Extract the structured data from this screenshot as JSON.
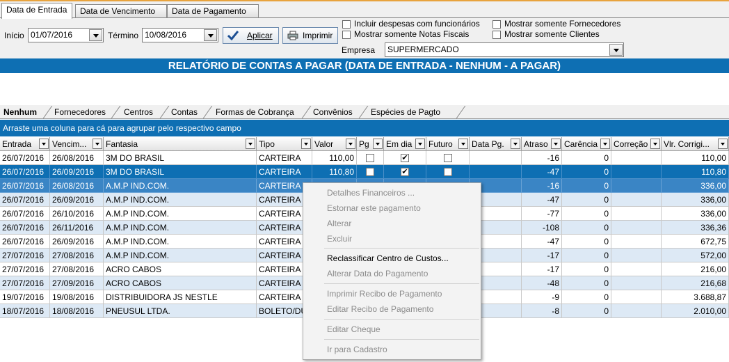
{
  "top_tabs": [
    "Data de Entrada",
    "Data de Vencimento",
    "Data de Pagamento"
  ],
  "filters": {
    "inicio_label": "Início",
    "inicio_value": "01/07/2016",
    "termino_label": "Término",
    "termino_value": "10/08/2016",
    "aplicar_label": "Aplicar",
    "imprimir_label": "Imprimir",
    "checks": [
      {
        "label": "Incluir despesas com funcionários",
        "checked": false
      },
      {
        "label": "Mostrar somente Notas Fiscais",
        "checked": false
      },
      {
        "label": "Mostrar somente Fornecedores",
        "checked": false
      },
      {
        "label": "Mostrar somente Clientes",
        "checked": false
      }
    ],
    "empresa_label": "Empresa",
    "empresa_value": "SUPERMERCADO"
  },
  "report_title": "RELATÓRIO DE CONTAS A PAGAR (DATA DE ENTRADA - NENHUM - A PAGAR)",
  "group_tabs": [
    "Nenhum",
    "Fornecedores",
    "Centros",
    "Contas",
    "Formas de Cobrança",
    "Convênios",
    "Espécies de Pagto"
  ],
  "group_hint": "Arraste uma coluna para cá para agrupar pelo respectivo campo",
  "columns": [
    "Entrada",
    "Vencim...",
    "Fantasia",
    "Tipo",
    "Valor",
    "Pg",
    "Em dia",
    "Futuro",
    "Data Pg.",
    "Atraso",
    "Carência",
    "Correção",
    "Vlr. Corrigi..."
  ],
  "rows": [
    [
      "26/07/2016",
      "26/08/2016",
      "3M DO BRASIL",
      "CARTEIRA",
      "110,00",
      "",
      "",
      "",
      "",
      "-16",
      "0",
      "",
      "110,00"
    ],
    [
      "26/07/2016",
      "26/09/2016",
      "3M DO BRASIL",
      "CARTEIRA",
      "110,80",
      "",
      "",
      "",
      "",
      "-47",
      "0",
      "",
      "110,80"
    ],
    [
      "26/07/2016",
      "26/08/2016",
      "A.M.P IND.COM.",
      "CARTEIRA",
      "",
      "",
      "",
      "",
      "",
      "-16",
      "0",
      "",
      "336,00"
    ],
    [
      "26/07/2016",
      "26/09/2016",
      "A.M.P IND.COM.",
      "CARTEIRA",
      "",
      "",
      "",
      "",
      "",
      "-47",
      "0",
      "",
      "336,00"
    ],
    [
      "26/07/2016",
      "26/10/2016",
      "A.M.P IND.COM.",
      "CARTEIRA",
      "",
      "",
      "",
      "",
      "",
      "-77",
      "0",
      "",
      "336,00"
    ],
    [
      "26/07/2016",
      "26/11/2016",
      "A.M.P IND.COM.",
      "CARTEIRA",
      "",
      "",
      "",
      "",
      "",
      "-108",
      "0",
      "",
      "336,36"
    ],
    [
      "26/07/2016",
      "26/09/2016",
      "A.M.P IND.COM.",
      "CARTEIRA",
      "",
      "",
      "",
      "",
      "",
      "-47",
      "0",
      "",
      "672,75"
    ],
    [
      "27/07/2016",
      "27/08/2016",
      "A.M.P IND.COM.",
      "CARTEIRA",
      "",
      "",
      "",
      "",
      "",
      "-17",
      "0",
      "",
      "572,00"
    ],
    [
      "27/07/2016",
      "27/08/2016",
      "ACRO CABOS",
      "CARTEIRA",
      "",
      "",
      "",
      "",
      "",
      "-17",
      "0",
      "",
      "216,00"
    ],
    [
      "27/07/2016",
      "27/09/2016",
      "ACRO CABOS",
      "CARTEIRA",
      "",
      "",
      "",
      "",
      "",
      "-48",
      "0",
      "",
      "216,68"
    ],
    [
      "19/07/2016",
      "19/08/2016",
      "DISTRIBUIDORA JS NESTLE",
      "CARTEIRA",
      "",
      "",
      "",
      "",
      "",
      "-9",
      "0",
      "",
      "3.688,87"
    ],
    [
      "18/07/2016",
      "18/08/2016",
      "PNEUSUL LTDA.",
      "BOLETO/DU",
      "",
      "",
      "",
      "",
      "",
      "-8",
      "0",
      "",
      "2.010,00"
    ]
  ],
  "row_checks": [
    {
      "pg": false,
      "em_dia": true,
      "futuro": false
    },
    {
      "pg": false,
      "em_dia": true,
      "futuro": false
    }
  ],
  "context_menu": [
    {
      "label": "Detalhes Financeiros ...",
      "enabled": false
    },
    {
      "label": "Estornar este pagamento",
      "enabled": false
    },
    {
      "label": "Alterar",
      "enabled": false
    },
    {
      "label": "Excluir",
      "enabled": false
    },
    {
      "label": "Reclassificar Centro de Custos...",
      "enabled": true
    },
    {
      "label": "Alterar Data do Pagamento",
      "enabled": false
    },
    {
      "label": "Imprimir Recibo de Pagamento",
      "enabled": false
    },
    {
      "label": "Editar Recibo de Pagamento",
      "enabled": false
    },
    {
      "label": "Editar Cheque",
      "enabled": false
    },
    {
      "label": "Ir para Cadastro",
      "enabled": false
    }
  ],
  "colors": {
    "accent": "#0e6fb3",
    "alt_row": "#dde9f5",
    "tab_border": "#e8a33d"
  }
}
